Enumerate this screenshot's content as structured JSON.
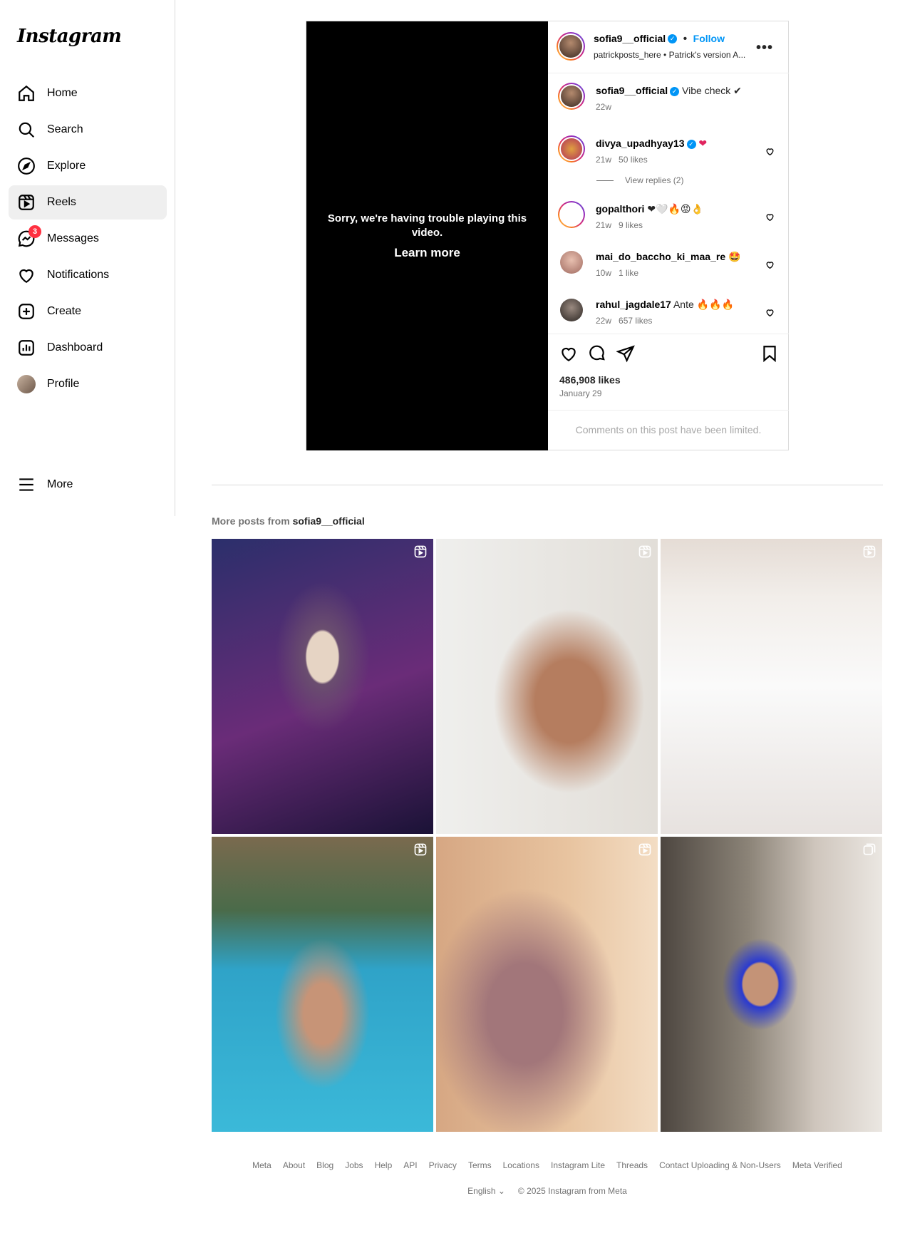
{
  "app": {
    "logo": "Instagram"
  },
  "nav": [
    {
      "label": "Home",
      "icon": "home-icon"
    },
    {
      "label": "Search",
      "icon": "search-icon"
    },
    {
      "label": "Explore",
      "icon": "explore-icon"
    },
    {
      "label": "Reels",
      "icon": "reels-icon",
      "active": true
    },
    {
      "label": "Messages",
      "icon": "messages-icon",
      "badge": "3"
    },
    {
      "label": "Notifications",
      "icon": "heart-icon"
    },
    {
      "label": "Create",
      "icon": "plus-icon"
    },
    {
      "label": "Dashboard",
      "icon": "dashboard-icon"
    },
    {
      "label": "Profile",
      "icon": "avatar"
    }
  ],
  "more": {
    "label": "More"
  },
  "video": {
    "error": "Sorry, we're having trouble playing this video.",
    "learn_more": "Learn more"
  },
  "post": {
    "author": "sofia9__official",
    "follow": "Follow",
    "dot": "•",
    "audio": "patrickposts_here • Patrick's version A...",
    "caption_text": "Vibe check ✔",
    "caption_time": "22w",
    "likes": "486,908 likes",
    "date": "January 29",
    "limited": "Comments on this post have been limited."
  },
  "comments": [
    {
      "user": "divya_upadhyay13",
      "verified": true,
      "text": "❤",
      "time": "21w",
      "likes": "50 likes"
    },
    {
      "user": "gopalthori",
      "text": "❤🤍🔥😡👌",
      "time": "21w",
      "likes": "9 likes"
    },
    {
      "user": "mai_do_baccho_ki_maa_re",
      "text": "🤩",
      "time": "10w",
      "likes": "1 like"
    },
    {
      "user": "rahul_jagdale17",
      "text": "Ante 🔥🔥🔥",
      "time": "22w",
      "likes": "657 likes"
    }
  ],
  "view_replies": "View replies (2)",
  "more_posts": {
    "prefix": "More posts from",
    "user": "sofia9__official"
  },
  "footer": {
    "links": [
      "Meta",
      "About",
      "Blog",
      "Jobs",
      "Help",
      "API",
      "Privacy",
      "Terms",
      "Locations",
      "Instagram Lite",
      "Threads",
      "Contact Uploading & Non-Users",
      "Meta Verified"
    ],
    "language": "English",
    "copyright": "© 2025 Instagram from Meta"
  }
}
